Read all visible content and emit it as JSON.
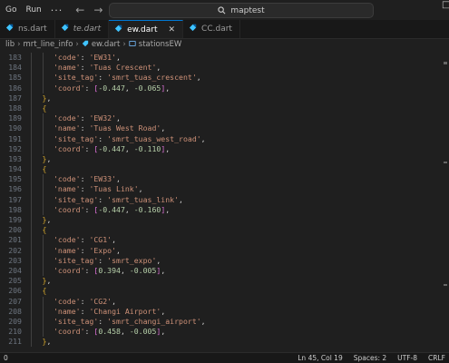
{
  "menu": {
    "go": "Go",
    "run": "Run",
    "more": "···"
  },
  "search": {
    "text": "maptest"
  },
  "tabs": [
    {
      "label": "ns.dart",
      "italic": false,
      "active": false
    },
    {
      "label": "te.dart",
      "italic": true,
      "active": false
    },
    {
      "label": "ew.dart",
      "italic": false,
      "active": true
    },
    {
      "label": "CC.dart",
      "italic": false,
      "active": false
    }
  ],
  "breadcrumb": [
    "lib",
    "mrt_line_info",
    "ew.dart",
    "stationsEW"
  ],
  "editor": {
    "lines": [
      {
        "n": "183",
        "html": "<span class='s'>'code'</span><span class='t'>: </span><span class='s'>'EW31'</span><span class='t'>,</span>",
        "indent": 2
      },
      {
        "n": "184",
        "html": "<span class='s'>'name'</span><span class='t'>: </span><span class='s'>'Tuas Crescent'</span><span class='t'>,</span>",
        "indent": 2
      },
      {
        "n": "185",
        "html": "<span class='s'>'site_tag'</span><span class='t'>: </span><span class='s'>'smrt_tuas_crescent'</span><span class='t'>,</span>",
        "indent": 2
      },
      {
        "n": "186",
        "html": "<span class='s'>'coord'</span><span class='t'>: </span><span class='b'>[</span><span class='n'>-0.447</span><span class='t'>, </span><span class='n'>-0.065</span><span class='b'>]</span><span class='t'>,</span>",
        "indent": 2
      },
      {
        "n": "187",
        "html": "<span class='p'>}</span><span class='t'>,</span>",
        "indent": 1
      },
      {
        "n": "188",
        "html": "<span class='p'>{</span>",
        "indent": 1
      },
      {
        "n": "189",
        "html": "<span class='s'>'code'</span><span class='t'>: </span><span class='s'>'EW32'</span><span class='t'>,</span>",
        "indent": 2
      },
      {
        "n": "190",
        "html": "<span class='s'>'name'</span><span class='t'>: </span><span class='s'>'Tuas West Road'</span><span class='t'>,</span>",
        "indent": 2
      },
      {
        "n": "191",
        "html": "<span class='s'>'site_tag'</span><span class='t'>: </span><span class='s'>'smrt_tuas_west_road'</span><span class='t'>,</span>",
        "indent": 2
      },
      {
        "n": "192",
        "html": "<span class='s'>'coord'</span><span class='t'>: </span><span class='b'>[</span><span class='n'>-0.447</span><span class='t'>, </span><span class='n'>-0.110</span><span class='b'>]</span><span class='t'>,</span>",
        "indent": 2
      },
      {
        "n": "193",
        "html": "<span class='p'>}</span><span class='t'>,</span>",
        "indent": 1
      },
      {
        "n": "194",
        "html": "<span class='p'>{</span>",
        "indent": 1
      },
      {
        "n": "195",
        "html": "<span class='s'>'code'</span><span class='t'>: </span><span class='s'>'EW33'</span><span class='t'>,</span>",
        "indent": 2
      },
      {
        "n": "196",
        "html": "<span class='s'>'name'</span><span class='t'>: </span><span class='s'>'Tuas Link'</span><span class='t'>,</span>",
        "indent": 2
      },
      {
        "n": "197",
        "html": "<span class='s'>'site_tag'</span><span class='t'>: </span><span class='s'>'smrt_tuas_link'</span><span class='t'>,</span>",
        "indent": 2
      },
      {
        "n": "198",
        "html": "<span class='s'>'coord'</span><span class='t'>: </span><span class='b'>[</span><span class='n'>-0.447</span><span class='t'>, </span><span class='n'>-0.160</span><span class='b'>]</span><span class='t'>,</span>",
        "indent": 2
      },
      {
        "n": "199",
        "html": "<span class='p'>}</span><span class='t'>,</span>",
        "indent": 1
      },
      {
        "n": "200",
        "html": "<span class='p'>{</span>",
        "indent": 1
      },
      {
        "n": "201",
        "html": "<span class='s'>'code'</span><span class='t'>: </span><span class='s'>'CG1'</span><span class='t'>,</span>",
        "indent": 2
      },
      {
        "n": "202",
        "html": "<span class='s'>'name'</span><span class='t'>: </span><span class='s'>'Expo'</span><span class='t'>,</span>",
        "indent": 2
      },
      {
        "n": "203",
        "html": "<span class='s'>'site_tag'</span><span class='t'>: </span><span class='s'>'smrt_expo'</span><span class='t'>,</span>",
        "indent": 2
      },
      {
        "n": "204",
        "html": "<span class='s'>'coord'</span><span class='t'>: </span><span class='b'>[</span><span class='n'>0.394</span><span class='t'>, </span><span class='n'>-0.005</span><span class='b'>]</span><span class='t'>,</span>",
        "indent": 2
      },
      {
        "n": "205",
        "html": "<span class='p'>}</span><span class='t'>,</span>",
        "indent": 1
      },
      {
        "n": "206",
        "html": "<span class='p'>{</span>",
        "indent": 1
      },
      {
        "n": "207",
        "html": "<span class='s'>'code'</span><span class='t'>: </span><span class='s'>'CG2'</span><span class='t'>,</span>",
        "indent": 2
      },
      {
        "n": "208",
        "html": "<span class='s'>'name'</span><span class='t'>: </span><span class='s'>'Changi Airport'</span><span class='t'>,</span>",
        "indent": 2
      },
      {
        "n": "209",
        "html": "<span class='s'>'site_tag'</span><span class='t'>: </span><span class='s'>'smrt_changi_airport'</span><span class='t'>,</span>",
        "indent": 2
      },
      {
        "n": "210",
        "html": "<span class='s'>'coord'</span><span class='t'>: </span><span class='b'>[</span><span class='n'>0.458</span><span class='t'>, </span><span class='n'>-0.005</span><span class='b'>]</span><span class='t'>,</span>",
        "indent": 2
      },
      {
        "n": "211",
        "html": "<span class='p'>}</span><span class='t'>,</span>",
        "indent": 1
      }
    ]
  },
  "status": {
    "left": "0",
    "position": "Ln 45, Col 19",
    "spaces": "Spaces: 2",
    "encoding": "UTF-8",
    "eol": "CRLF"
  },
  "colors": {
    "accent": "#0078d4",
    "string": "#ce9178",
    "number": "#b5cea8",
    "brace": "#d4a72c",
    "bracket": "#da70d6"
  }
}
